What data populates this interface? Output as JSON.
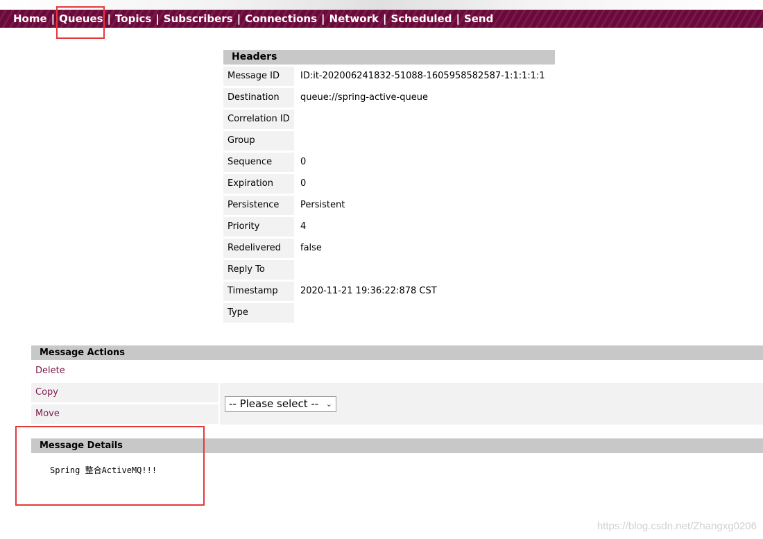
{
  "nav": {
    "items": [
      "Home",
      "Queues",
      "Topics",
      "Subscribers",
      "Connections",
      "Network",
      "Scheduled",
      "Send"
    ],
    "separator": "|"
  },
  "headers": {
    "title": "Headers",
    "rows": [
      {
        "label": "Message ID",
        "value": "ID:it-202006241832-51088-1605958582587-1:1:1:1:1"
      },
      {
        "label": "Destination",
        "value": "queue://spring-active-queue"
      },
      {
        "label": "Correlation ID",
        "value": ""
      },
      {
        "label": "Group",
        "value": ""
      },
      {
        "label": "Sequence",
        "value": "0"
      },
      {
        "label": "Expiration",
        "value": "0"
      },
      {
        "label": "Persistence",
        "value": "Persistent"
      },
      {
        "label": "Priority",
        "value": "4"
      },
      {
        "label": "Redelivered",
        "value": "false"
      },
      {
        "label": "Reply To",
        "value": ""
      },
      {
        "label": "Timestamp",
        "value": "2020-11-21 19:36:22:878 CST"
      },
      {
        "label": "Type",
        "value": ""
      }
    ]
  },
  "actions": {
    "title": "Message Actions",
    "delete_label": "Delete",
    "copy_label": "Copy",
    "move_label": "Move",
    "select_value": "-- Please select --"
  },
  "details": {
    "title": "Message Details",
    "body": "Spring 整合ActiveMQ!!!"
  },
  "watermark": "https://blog.csdn.net/Zhangxg0206",
  "colors": {
    "nav_bg": "#6a0a3a",
    "link": "#7a1a4a",
    "section_bg": "#c8c8c8",
    "label_bg": "#f2f2f2",
    "highlight": "#e5383b"
  }
}
